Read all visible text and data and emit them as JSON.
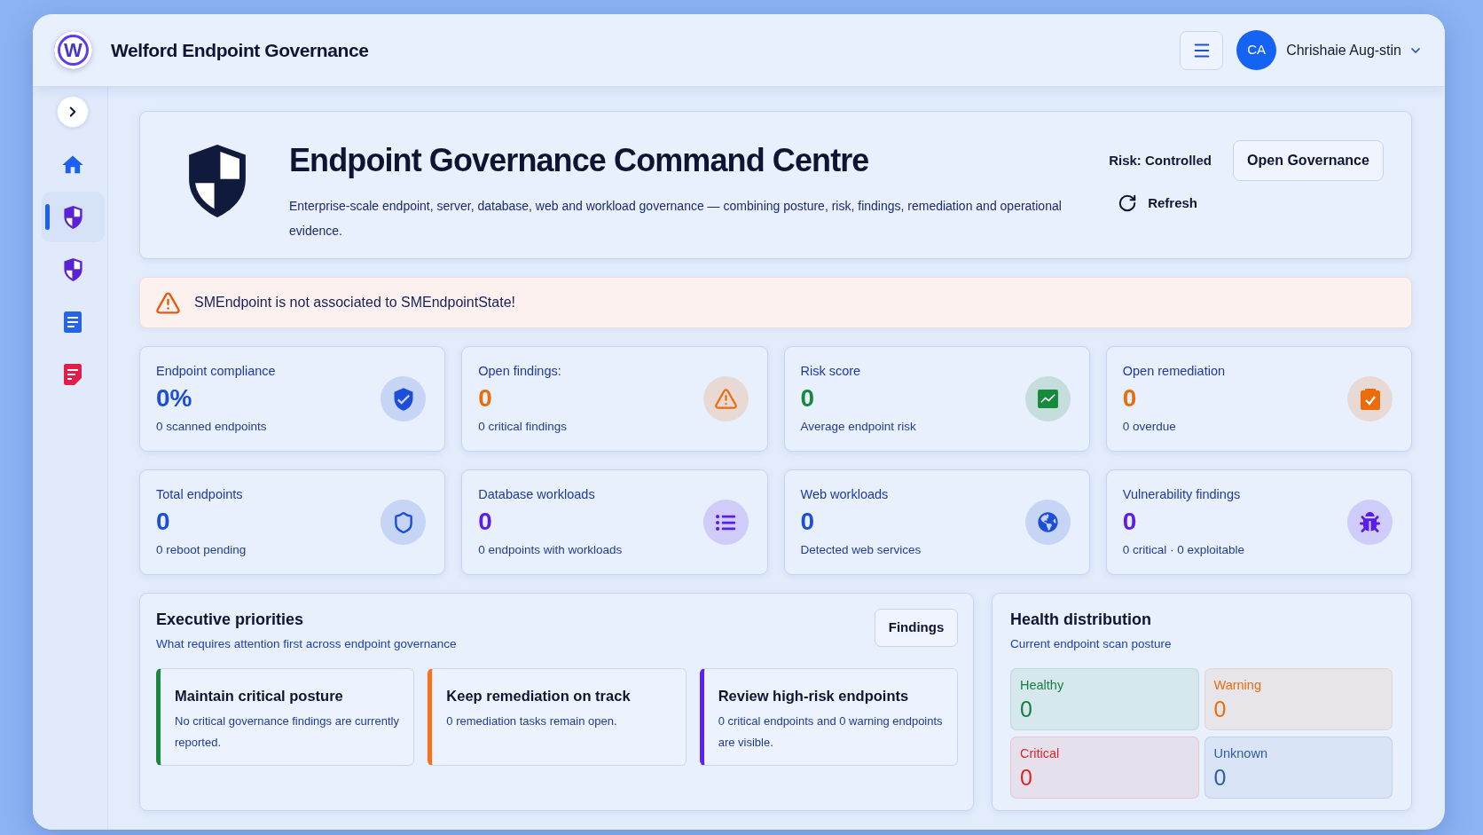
{
  "header": {
    "logo_text": "W",
    "title": "Welford Endpoint Governance",
    "user": {
      "initials": "CA",
      "name": "Chrishaie Aug-stin"
    }
  },
  "sidebar": {
    "items": [
      {
        "kind": "home",
        "selected": false
      },
      {
        "kind": "shield",
        "selected": true
      },
      {
        "kind": "shield",
        "selected": false
      },
      {
        "kind": "document",
        "selected": false
      },
      {
        "kind": "report",
        "selected": false
      }
    ]
  },
  "hero": {
    "title": "Endpoint Governance Command Centre",
    "description": "Enterprise-scale endpoint, server, database, web and workload governance — combining posture, risk, findings, remediation and operational evidence.",
    "risk": "Risk: Controlled",
    "primary_button": "Open Governance",
    "refresh_button": "Refresh"
  },
  "alert": {
    "message": "SMEndpoint is not associated to SMEndpointState!"
  },
  "stats": [
    {
      "kind": "compliance",
      "label": "Endpoint compliance",
      "value": "0%",
      "detail": "0 scanned endpoints",
      "color": "#1d4ed8"
    },
    {
      "kind": "findings",
      "label": "Open findings:",
      "value": "0",
      "detail": "0 critical findings",
      "color": "#ea6c0a"
    },
    {
      "kind": "risk",
      "label": "Risk score",
      "value": "0",
      "detail": "Average endpoint risk",
      "color": "#168a3c"
    },
    {
      "kind": "remediation",
      "label": "Open remediation",
      "value": "0",
      "detail": "0 overdue",
      "color": "#ea6c0a"
    },
    {
      "kind": "endpoints",
      "label": "Total endpoints",
      "value": "0",
      "detail": "0 reboot pending",
      "color": "#1d4ed8"
    },
    {
      "kind": "database",
      "label": "Database workloads",
      "value": "0",
      "detail": "0 endpoints with workloads",
      "color": "#5b1ee6"
    },
    {
      "kind": "web",
      "label": "Web workloads",
      "value": "0",
      "detail": "Detected web services",
      "color": "#1d4ed8"
    },
    {
      "kind": "vulnerability",
      "label": "Vulnerability findings",
      "value": "0",
      "detail": "0 critical · 0 exploitable",
      "color": "#5b1ee6"
    }
  ],
  "priorities": {
    "title": "Executive priorities",
    "subtitle": "What requires attention first across endpoint governance",
    "button": "Findings",
    "items": [
      {
        "title": "Maintain critical posture",
        "text": "No critical governance findings are currently reported.",
        "color": "#16893a"
      },
      {
        "title": "Keep remediation on track",
        "text": "0 remediation tasks remain open.",
        "color": "#f97316"
      },
      {
        "title": "Review high-risk endpoints",
        "text": "0 critical endpoints and 0 warning endpoints are visible.",
        "color": "#5b21f6"
      }
    ]
  },
  "health": {
    "title": "Health distribution",
    "subtitle": "Current endpoint scan posture",
    "tiles": [
      {
        "label": "Healthy",
        "value": "0",
        "color": "#15803d"
      },
      {
        "label": "Warning",
        "value": "0",
        "color": "#ea6c0a"
      },
      {
        "label": "Critical",
        "value": "0",
        "color": "#dc2626"
      },
      {
        "label": "Unknown",
        "value": "0",
        "color": "#2f5ca8"
      }
    ]
  }
}
